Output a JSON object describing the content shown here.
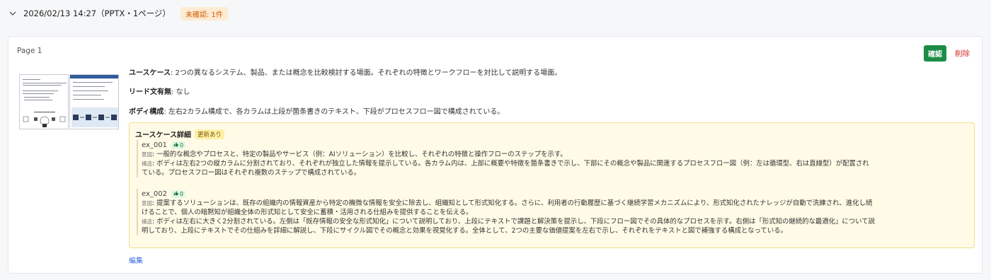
{
  "group": {
    "title": "2026/02/13 14:27（PPTX・1ページ）",
    "unconfirmed_badge": "未確認: 1件"
  },
  "card": {
    "page_label": "Page 1",
    "confirm_label": "確認",
    "delete_label": "削除",
    "usecase_label": "ユースケース",
    "usecase_value": ": 2つの異なるシステム、製品、または概念を比較検討する場面。それぞれの特徴とワークフローを対比して説明する場面。",
    "lead_label": "リード文有無",
    "lead_value": ": なし",
    "body_label": "ボディ構成",
    "body_value": ": 左右2カラム構成で、各カラムは上段が箇条書きのテキスト、下段がプロセスフロー図で構成されている。",
    "edit_label": "編集"
  },
  "detail": {
    "title": "ユースケース詳細",
    "updated_badge": "更新あり",
    "intent_label": "意図",
    "structure_label": "構造",
    "examples": [
      {
        "id": "ex_001",
        "likes": "0",
        "intent_lines": [
          ": 一般的な概念やプロセスと、特定の製品やサービス（例：AIソリューション）を比較し、それぞれの特徴と操作フローのステップを示す。"
        ],
        "structure_lines": [
          ": ボディは左右2つの縦カラムに分割されており、それぞれが独立した情報を提示している。各カラム内は、上部に概要や特徴を箇条書きで示し、下部にその概念や製品に関連するプロセスフロー図（例：左は循環型、右は直線型）が配置され",
          "ている。プロセスフロー図はそれぞれ複数のステップで構成されている。"
        ]
      },
      {
        "id": "ex_002",
        "likes": "0",
        "intent_lines": [
          ": 提案するソリューションは、既存の組織内の情報資産から特定の機微な情報を安全に除去し、組織知として形式知化する。さらに、利用者の行動履歴に基づく継続学習メカニズムにより、形式知化されたナレッジが自動で洗練され、進化し続",
          "けることで、個人の暗黙知が組織全体の形式知として安全に蓄積・活用される仕組みを提供することを伝える。"
        ],
        "structure_lines": [
          ": ボディは左右に大きく2分割されている。左側は「既存情報の安全な形式知化」について説明しており、上段にテキストで課題と解決策を提示し、下段にフロー図でその具体的なプロセスを示す。右側は「形式知の継続的な最適化」について説",
          "明しており、上段にテキストでその仕組みを詳細に解説し、下段にサイクル図でその概念と効果を視覚化する。全体として、2つの主要な価値提案を左右で示し、それぞれをテキストと図で補強する構成となっている。"
        ]
      }
    ]
  },
  "colors": {
    "confirm_bg": "#1c8c47",
    "delete_text": "#d0302a",
    "unconfirmed_bg": "#fdebd3",
    "unconfirmed_text": "#d45b00",
    "detail_bg": "#fffbe6",
    "link": "#3366dd"
  },
  "icons": [
    "chevron-down-icon",
    "thumbs-up-icon"
  ]
}
